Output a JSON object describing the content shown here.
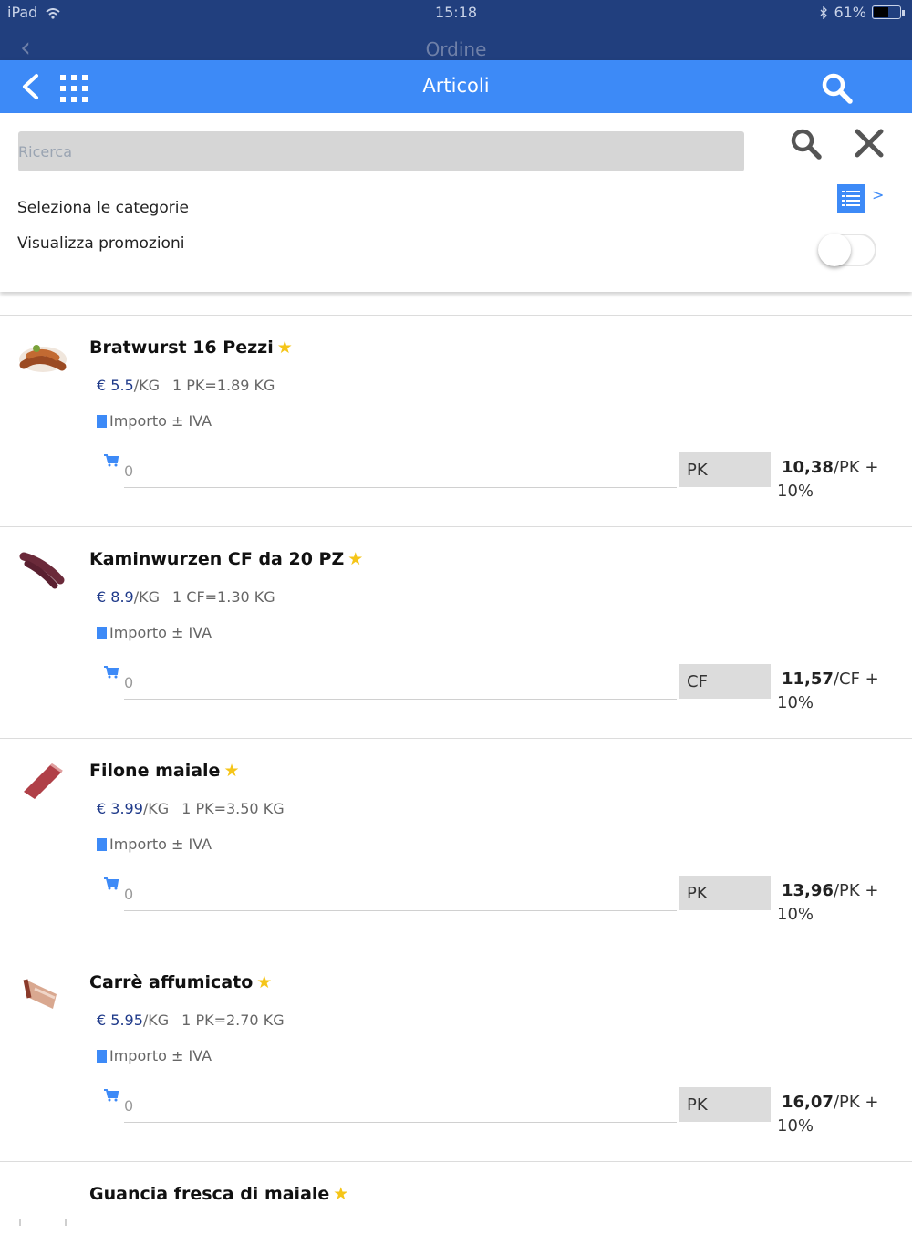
{
  "status_bar": {
    "device": "iPad",
    "time": "15:18",
    "battery": "61%",
    "battery_level": 0.61
  },
  "background_nav": {
    "title": "Ordine"
  },
  "navbar": {
    "title": "Articoli"
  },
  "filter": {
    "search_placeholder": "Ricerca",
    "categories_label": "Seleziona le categorie",
    "categories_chevron": ">",
    "promotions_label": "Visualizza promozioni",
    "promotions_enabled": false
  },
  "products": [
    {
      "name": "Bratwurst 16 Pezzi",
      "star": "★",
      "price": "€ 5.5",
      "price_unit": "/KG",
      "pack": "1 PK=1.89 KG",
      "vat_label": "Importo ± IVA",
      "qty_placeholder": "0",
      "unit": "PK",
      "total": "10,38",
      "total_suffix": "/PK +",
      "vat_rate": "10%"
    },
    {
      "name": "Kaminwurzen CF da 20 PZ",
      "star": "★",
      "price": "€ 8.9",
      "price_unit": "/KG",
      "pack": "1 CF=1.30 KG",
      "vat_label": "Importo ± IVA",
      "qty_placeholder": "0",
      "unit": "CF",
      "total": "11,57",
      "total_suffix": "/CF +",
      "vat_rate": "10%"
    },
    {
      "name": "Filone maiale",
      "star": "★",
      "price": "€ 3.99",
      "price_unit": "/KG",
      "pack": "1 PK=3.50 KG",
      "vat_label": "Importo ± IVA",
      "qty_placeholder": "0",
      "unit": "PK",
      "total": "13,96",
      "total_suffix": "/PK +",
      "vat_rate": "10%"
    },
    {
      "name": "Carrè affumicato",
      "star": "★",
      "price": "€ 5.95",
      "price_unit": "/KG",
      "pack": "1 PK=2.70 KG",
      "vat_label": "Importo ± IVA",
      "qty_placeholder": "0",
      "unit": "PK",
      "total": "16,07",
      "total_suffix": "/PK +",
      "vat_rate": "10%"
    },
    {
      "name": "Guancia fresca di maiale",
      "star": "★"
    }
  ]
}
